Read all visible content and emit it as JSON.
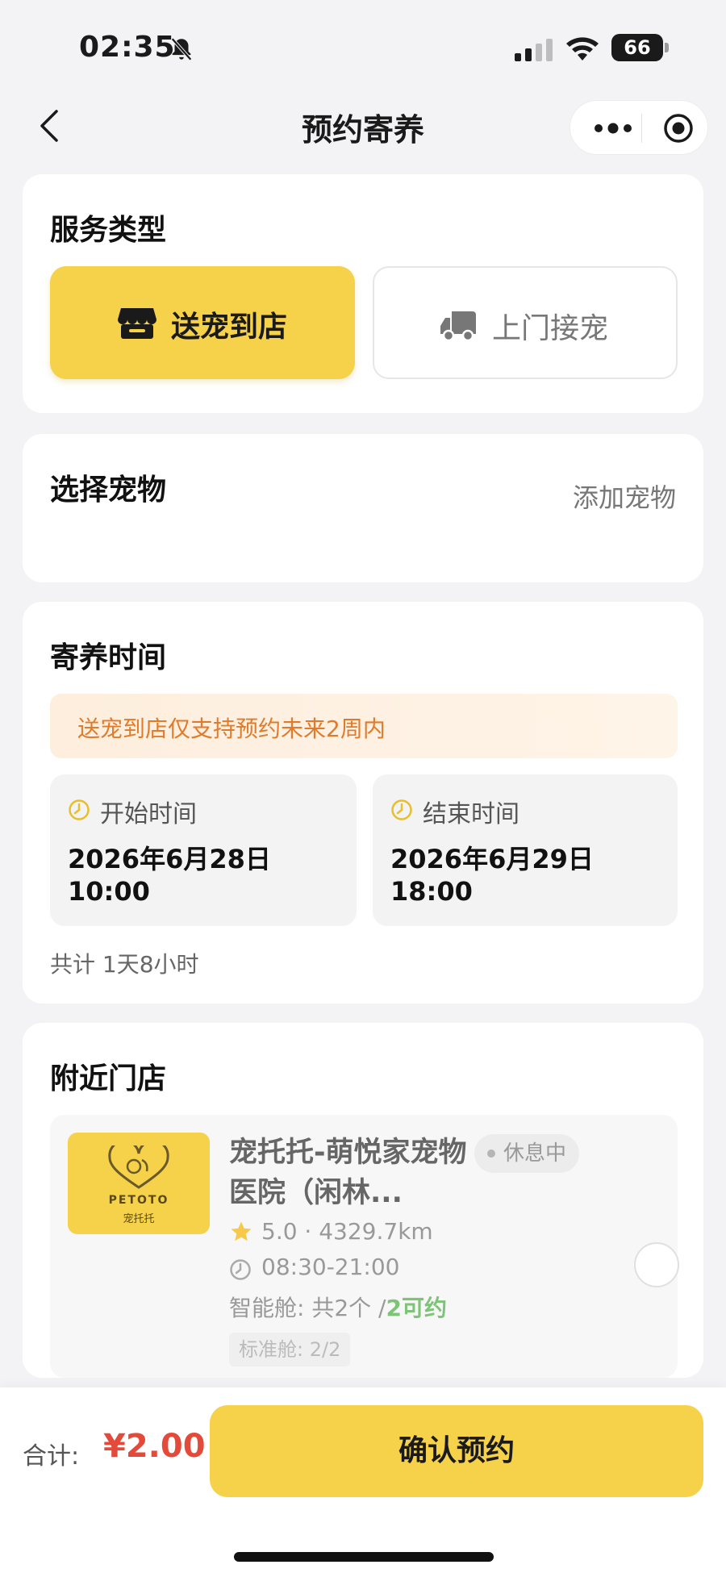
{
  "status_bar": {
    "time": "02:35",
    "battery": "66"
  },
  "nav": {
    "title": "预约寄养"
  },
  "service_type": {
    "title": "服务类型",
    "options": [
      {
        "label": "送宠到店",
        "selected": true,
        "icon": "store-icon"
      },
      {
        "label": "上门接宠",
        "selected": false,
        "icon": "truck-icon"
      }
    ]
  },
  "pet": {
    "title": "选择宠物",
    "add_label": "添加宠物"
  },
  "boarding_time": {
    "title": "寄养时间",
    "notice": "送宠到店仅支持预约未来2周内",
    "start": {
      "label": "开始时间",
      "date": "2026年6月28日",
      "hour": "10:00"
    },
    "end": {
      "label": "结束时间",
      "date": "2026年6月29日",
      "hour": "18:00"
    },
    "duration": "共计 1天8小时"
  },
  "stores": {
    "title": "附近门店",
    "items": [
      {
        "logo_en": "PETOTO",
        "logo_cn": "宠托托",
        "name": "宠托托-萌悦家宠物医院（闲林...",
        "status": "休息中",
        "rating_distance": "5.0 · 4329.7km",
        "hours": "08:30-21:00",
        "capsule_prefix": "智能舱: 共2个 /",
        "capsule_available": "2可约",
        "standard": "标准舱: 2/2"
      }
    ]
  },
  "footer": {
    "total_label": "合计:",
    "total_amount": "¥2.00",
    "confirm_label": "确认预约"
  },
  "colors": {
    "accent": "#f6d14a",
    "price": "#e34a3a",
    "notice_text": "#e07b2c",
    "available": "#7cc576"
  }
}
